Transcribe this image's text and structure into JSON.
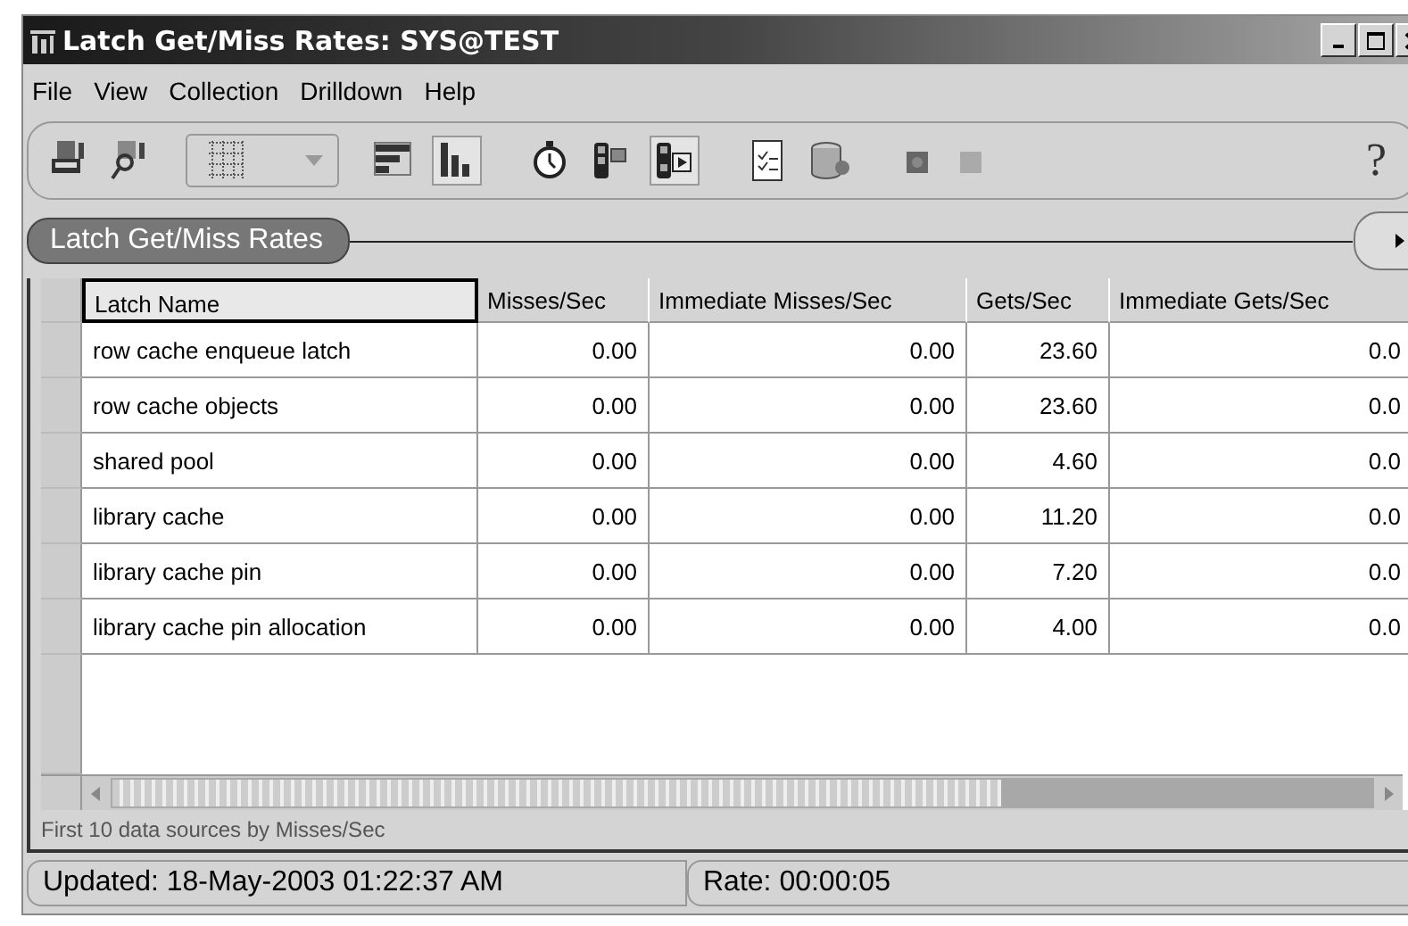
{
  "window": {
    "title": "Latch Get/Miss Rates: SYS@TEST"
  },
  "menu": [
    "File",
    "View",
    "Collection",
    "Drilldown",
    "Help"
  ],
  "toolbar": {
    "help_glyph": "?"
  },
  "panel": {
    "title": "Latch Get/Miss Rates"
  },
  "table": {
    "columns": [
      "Latch Name",
      "Misses/Sec",
      "Immediate Misses/Sec",
      "Gets/Sec",
      "Immediate Gets/Sec"
    ],
    "rows": [
      [
        "row cache enqueue latch",
        "0.00",
        "0.00",
        "23.60",
        "0.0"
      ],
      [
        "row cache objects",
        "0.00",
        "0.00",
        "23.60",
        "0.0"
      ],
      [
        "shared pool",
        "0.00",
        "0.00",
        "4.60",
        "0.0"
      ],
      [
        "library cache",
        "0.00",
        "0.00",
        "11.20",
        "0.0"
      ],
      [
        "library cache pin",
        "0.00",
        "0.00",
        "7.20",
        "0.0"
      ],
      [
        "library cache pin allocation",
        "0.00",
        "0.00",
        "4.00",
        "0.0"
      ]
    ]
  },
  "caption": "First 10 data sources by Misses/Sec",
  "status_bar": [
    "Updated: 18-May-2003 01:22:37 AM",
    "Rate: 00:00:05"
  ]
}
